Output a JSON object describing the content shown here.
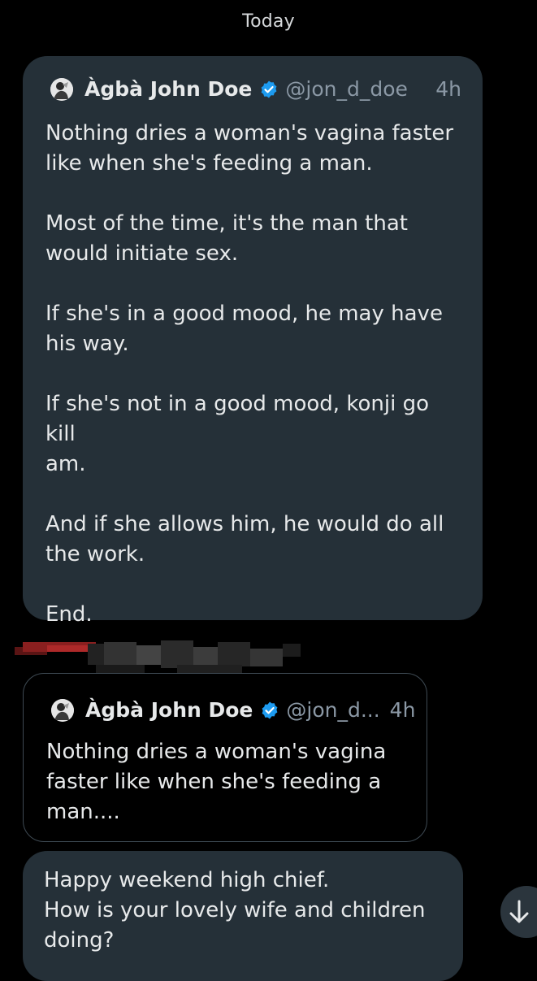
{
  "date_separator": "Today",
  "shared_post": {
    "author_name": "Àgbà John Doe",
    "handle": "@jon_d_doe",
    "time": "4h",
    "verified_color": "#1d9bf0",
    "text": "Nothing dries a woman's vagina faster\nlike when she's feeding a man.\n\nMost of the time, it's the man that\nwould initiate sex.\n\nIf she's in a good mood, he may have\nhis way.\n\nIf she's not in a good mood, konji go kill\nam.\n\nAnd if she allows him, he would do all\nthe work.\n\nEnd."
  },
  "reply": {
    "quoted_post": {
      "author_name": "Àgbà John Doe",
      "handle": "@jon_d...",
      "time": "4h",
      "text": "Nothing dries a woman's vagina\nfaster like when she's feeding a\nman...."
    },
    "message": "Happy weekend high chief.\nHow is your lovely wife and children\ndoing?"
  },
  "scroll_button_icon": "arrow-down-icon"
}
